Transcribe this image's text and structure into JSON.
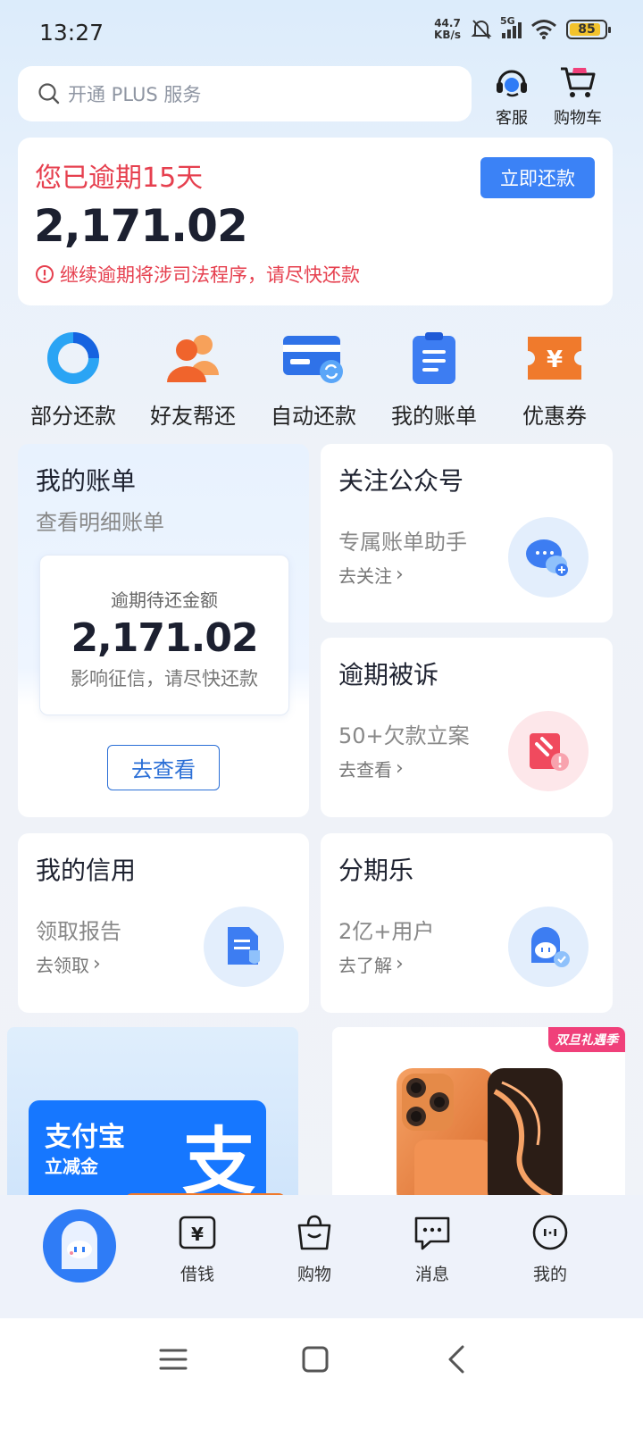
{
  "status_bar": {
    "time": "13:27",
    "net_speed_value": "44.7",
    "net_speed_unit": "KB/s",
    "network": "5G",
    "battery": "85"
  },
  "search": {
    "placeholder": "开通 PLUS 服务"
  },
  "top_actions": [
    {
      "label": "客服",
      "icon": "headset-icon"
    },
    {
      "label": "购物车",
      "icon": "cart-icon"
    }
  ],
  "overdue": {
    "title": "您已逾期15天",
    "amount": "2,171.02",
    "warning": "继续逾期将涉司法程序，请尽快还款",
    "button": "立即还款"
  },
  "quick_actions": [
    {
      "label": "部分还款",
      "icon": "ring-chart-icon"
    },
    {
      "label": "好友帮还",
      "icon": "friends-icon"
    },
    {
      "label": "自动还款",
      "icon": "card-refresh-icon"
    },
    {
      "label": "我的账单",
      "icon": "bill-icon"
    },
    {
      "label": "优惠券",
      "icon": "coupon-icon"
    }
  ],
  "bill_card": {
    "title": "我的账单",
    "subtitle": "查看明细账单",
    "inner_label": "逾期待还金额",
    "inner_amount": "2,171.02",
    "inner_note": "影响征信，请尽快还款",
    "button": "去查看"
  },
  "cards": {
    "follow": {
      "title": "关注公众号",
      "sub": "专属账单助手",
      "link": "去关注"
    },
    "sued": {
      "title": "逾期被诉",
      "sub": "50+欠款立案",
      "link": "去查看"
    },
    "credit": {
      "title": "我的信用",
      "sub": "领取报告",
      "link": "去领取"
    },
    "installment": {
      "title": "分期乐",
      "sub": "2亿+用户",
      "link": "去了解"
    }
  },
  "banners": {
    "alipay_name": "支付宝",
    "alipay_sub": "立减金",
    "alipay_logo": "支",
    "promo_tag": "双旦礼遇季"
  },
  "tabbar": [
    {
      "label": "借钱",
      "icon": "yen-icon"
    },
    {
      "label": "购物",
      "icon": "shopping-bag-icon"
    },
    {
      "label": "消息",
      "icon": "message-icon"
    },
    {
      "label": "我的",
      "icon": "profile-icon"
    }
  ],
  "colors": {
    "accent": "#3b82f6",
    "danger": "#e6404f",
    "orange": "#f07a2c"
  }
}
